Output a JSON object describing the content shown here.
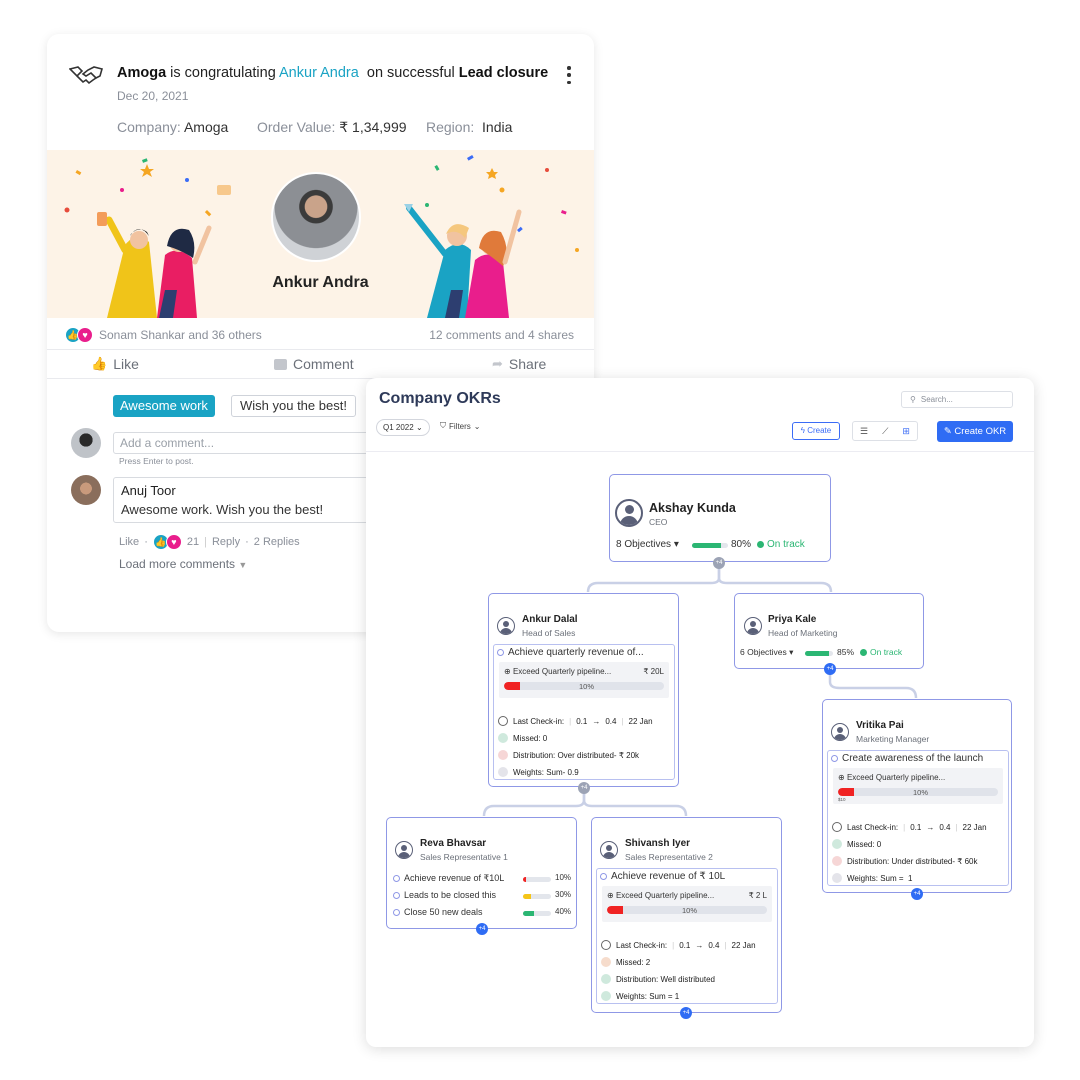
{
  "feed": {
    "title_actor": "Amoga",
    "title_mid": " is congratulating ",
    "title_target": "Ankur Andra",
    "title_after": "  on successful ",
    "title_event": "Lead closure",
    "date": "Dec 20, 2021",
    "company_label": "Company:",
    "company_value": "Amoga",
    "order_label": "Order Value:",
    "order_value": "₹ 1,34,999",
    "region_label": "Region:",
    "region_value": "India",
    "banner_name": "Ankur Andra",
    "reactions_text": "Sonam Shankar and 36 others",
    "comments_shares": "12 comments and 4 shares",
    "like_label": "Like",
    "comment_label": "Comment",
    "share_label": "Share",
    "chip_1": "Awesome work",
    "chip_2": "Wish you the best!",
    "comment_placeholder": "Add a comment...",
    "press_enter": "Press Enter to post.",
    "comment_author": "Anuj Toor",
    "comment_text": "Awesome work. Wish you the best!",
    "comment_like": "Like",
    "comment_count": "21",
    "comment_reply": "Reply",
    "comment_replies": "2 Replies",
    "load_more": "Load more comments"
  },
  "okr": {
    "title": "Company OKRs",
    "search_placeholder": "Search...",
    "quarter": "Q1 2022",
    "filters": "Filters",
    "create": "Create",
    "create_okr": "Create OKR",
    "akshay": {
      "name": "Akshay Kunda",
      "role": "CEO",
      "objectives": "8 Objectives",
      "progress": 80,
      "pct": "80%",
      "status": "On track"
    },
    "ankur": {
      "name": "Ankur Dalal",
      "role": "Head of Sales",
      "objective": "Achieve quarterly revenue of...",
      "kr": "Exceed Quarterly pipeline...",
      "kr_value": "₹ 20L",
      "kr_progress": 10,
      "kr_pct": "10%",
      "checkin_label": "Last Check-in:",
      "checkin_from": "0.1",
      "checkin_to": "0.4",
      "checkin_date": "22 Jan",
      "missed": "Missed: 0",
      "distribution": "Distribution: Over distributed- ₹ 20k",
      "weights": "Weights: Sum- 0.9"
    },
    "priya": {
      "name": "Priya Kale",
      "role": "Head of Marketing",
      "objectives": "6 Objectives",
      "progress": 85,
      "pct": "85%",
      "status": "On track"
    },
    "vritika": {
      "name": "Vritika Pai",
      "role": "Marketing Manager",
      "objective": "Create awareness of the launch",
      "kr": "Exceed Quarterly pipeline...",
      "kr_progress": 10,
      "kr_pct": "10%",
      "kr_min": "$10",
      "checkin_label": "Last Check-in:",
      "checkin_from": "0.1",
      "checkin_to": "0.4",
      "checkin_date": "22 Jan",
      "missed": "Missed: 0",
      "distribution": "Distribution: Under distributed- ₹ 60k",
      "weights": "Weights: Sum =  1"
    },
    "reva": {
      "name": "Reva Bhavsar",
      "role": "Sales Representative 1",
      "items": [
        {
          "label": "Achieve revenue of ₹10L",
          "pct": "10%",
          "progress": 10,
          "color": "#f02323"
        },
        {
          "label": "Leads to be closed this",
          "pct": "30%",
          "progress": 30,
          "color": "#f5c518"
        },
        {
          "label": "Close 50 new deals",
          "pct": "40%",
          "progress": 40,
          "color": "#2bb673"
        }
      ]
    },
    "shivansh": {
      "name": "Shivansh Iyer",
      "role": "Sales Representative 2",
      "objective": "Achieve revenue of ₹ 10L",
      "kr": "Exceed Quarterly pipeline...",
      "kr_value": "₹ 2 L",
      "kr_progress": 10,
      "kr_pct": "10%",
      "checkin_label": "Last Check-in:",
      "checkin_from": "0.1",
      "checkin_to": "0.4",
      "checkin_date": "22 Jan",
      "missed": "Missed: 2",
      "distribution": "Distribution: Well distributed",
      "weights": "Weights: Sum = 1"
    },
    "expand_badge": "+4",
    "colors": {
      "accent": "#2f6cf4",
      "node_border": "#8f98e6",
      "on_track": "#2bb673",
      "behind": "#f02323",
      "link": "#1aa3c4"
    }
  }
}
